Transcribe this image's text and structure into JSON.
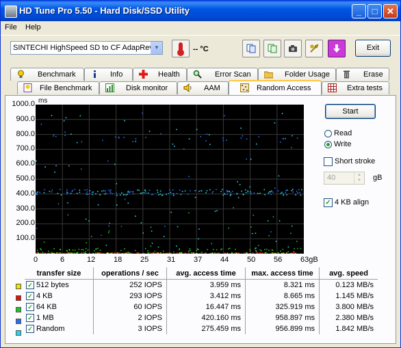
{
  "window": {
    "title": "HD Tune Pro 5.50 - Hard Disk/SSD Utility",
    "min_glyph": "_",
    "max_glyph": "□",
    "close_glyph": "✕"
  },
  "menu": {
    "items": [
      "File",
      "Help"
    ]
  },
  "toolbar": {
    "drive": "SINTECHI HighSpeed SD to CF AdapRev",
    "temperature": "-- °C",
    "exit_label": "Exit"
  },
  "tabs": {
    "row1": [
      "Benchmark",
      "Info",
      "Health",
      "Error Scan",
      "Folder Usage",
      "Erase"
    ],
    "row2": [
      "File Benchmark",
      "Disk monitor",
      "AAM",
      "Random Access",
      "Extra tests"
    ],
    "active": "Random Access"
  },
  "controls": {
    "start_label": "Start",
    "read_label": "Read",
    "write_label": "Write",
    "mode": "Write",
    "short_stroke_label": "Short stroke",
    "short_stroke_checked": false,
    "stroke_value": "40",
    "stroke_unit": "gB",
    "align_label": "4 KB align",
    "align_checked": true
  },
  "chart_data": {
    "type": "scatter",
    "ylabel": "ms",
    "ylim": [
      0,
      1000
    ],
    "xlim": [
      0,
      63
    ],
    "y_ticks": [
      "1000.0",
      "900.0",
      "800.0",
      "700.0",
      "600.0",
      "500.0",
      "400.0",
      "300.0",
      "200.0",
      "100.0"
    ],
    "x_ticks": [
      "0",
      "6",
      "12",
      "18",
      "25",
      "31",
      "37",
      "44",
      "50",
      "56",
      "63gB"
    ],
    "grid": true,
    "series": [
      {
        "name": "512 bytes",
        "color": "#e8e800",
        "avg_ms": 3.959,
        "max_ms": 8.321
      },
      {
        "name": "4 KB",
        "color": "#e01010",
        "avg_ms": 3.412,
        "max_ms": 8.665
      },
      {
        "name": "64 KB",
        "color": "#22c422",
        "avg_ms": 16.447,
        "max_ms": 325.919
      },
      {
        "name": "1 MB",
        "color": "#2a6ef0",
        "avg_ms": 420.16,
        "max_ms": 958.897
      },
      {
        "name": "Random",
        "color": "#2ad4e8",
        "avg_ms": 275.459,
        "max_ms": 956.899
      }
    ]
  },
  "table": {
    "headers": [
      "transfer size",
      "operations / sec",
      "avg. access time",
      "max. access time",
      "avg. speed"
    ],
    "rows": [
      {
        "size": "512 bytes",
        "color": "#e8e800",
        "ops": "252 IOPS",
        "avg": "3.959 ms",
        "max": "8.321 ms",
        "speed": "0.123 MB/s"
      },
      {
        "size": "4 KB",
        "color": "#e01010",
        "ops": "293 IOPS",
        "avg": "3.412 ms",
        "max": "8.665 ms",
        "speed": "1.145 MB/s"
      },
      {
        "size": "64 KB",
        "color": "#22c422",
        "ops": "60 IOPS",
        "avg": "16.447 ms",
        "max": "325.919 ms",
        "speed": "3.800 MB/s"
      },
      {
        "size": "1 MB",
        "color": "#2a6ef0",
        "ops": "2 IOPS",
        "avg": "420.160 ms",
        "max": "958.897 ms",
        "speed": "2.380 MB/s"
      },
      {
        "size": "Random",
        "color": "#2ad4e8",
        "ops": "3 IOPS",
        "avg": "275.459 ms",
        "max": "956.899 ms",
        "speed": "1.842 MB/s"
      }
    ]
  }
}
